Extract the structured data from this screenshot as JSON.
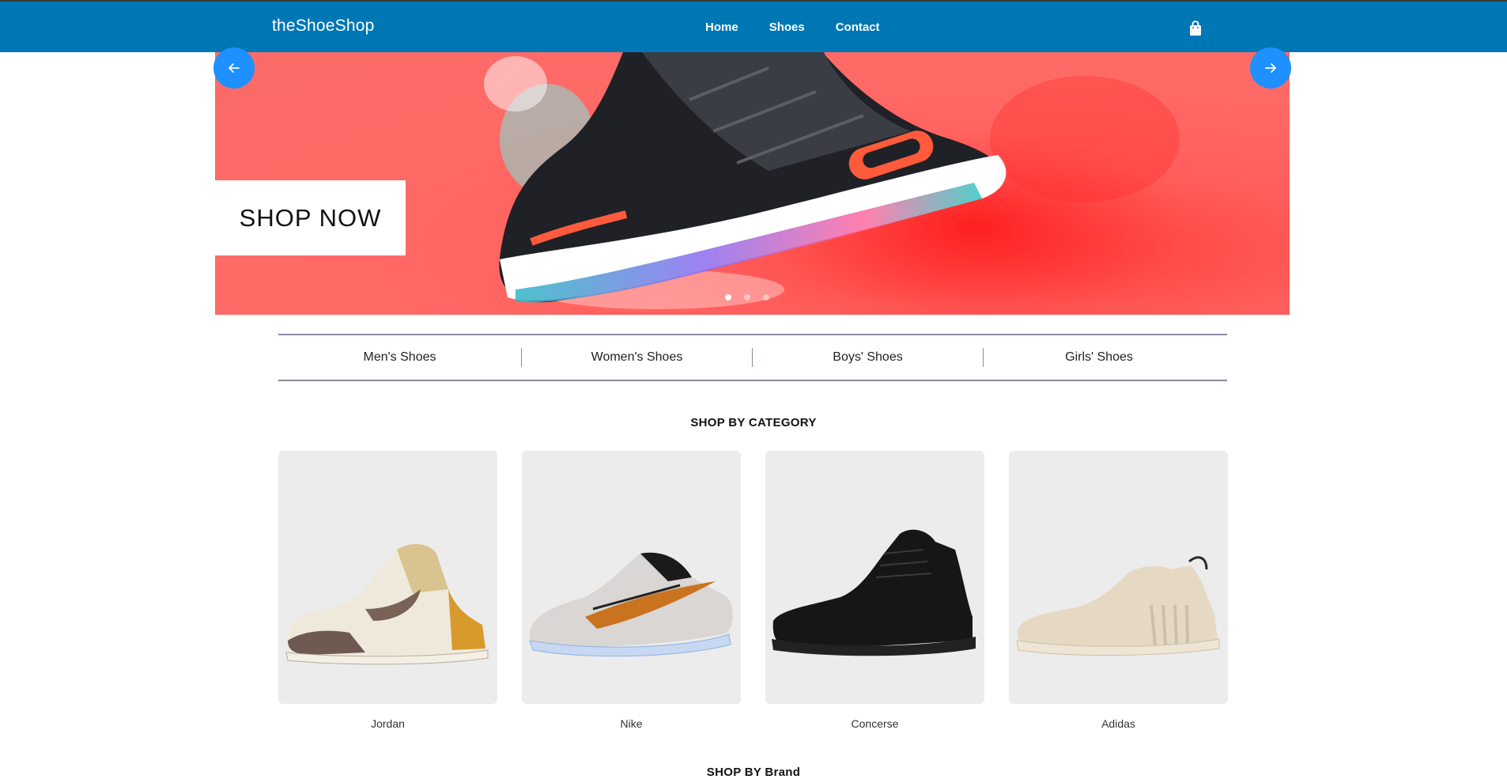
{
  "navbar": {
    "brand": "theShoeShop",
    "links": [
      "Home",
      "Shoes",
      "Contact"
    ],
    "background": "#0077b5",
    "cart_icon": "shopping-bag-icon"
  },
  "hero": {
    "cta_label": "SHOP NOW",
    "prev_icon": "arrow-left-icon",
    "next_icon": "arrow-right-icon",
    "slide_count": 3,
    "active_slide": 1,
    "background": "#fb6a68"
  },
  "categories": [
    "Men's Shoes",
    "Women's Shoes",
    "Boys' Shoes",
    "Girls' Shoes"
  ],
  "shop_by_category": {
    "title": "SHOP BY CATEGORY",
    "cards": [
      {
        "label": "Jordan"
      },
      {
        "label": "Nike"
      },
      {
        "label": "Concerse"
      },
      {
        "label": "Adidas"
      }
    ]
  },
  "shop_by_brand": {
    "title": "SHOP BY Brand"
  }
}
